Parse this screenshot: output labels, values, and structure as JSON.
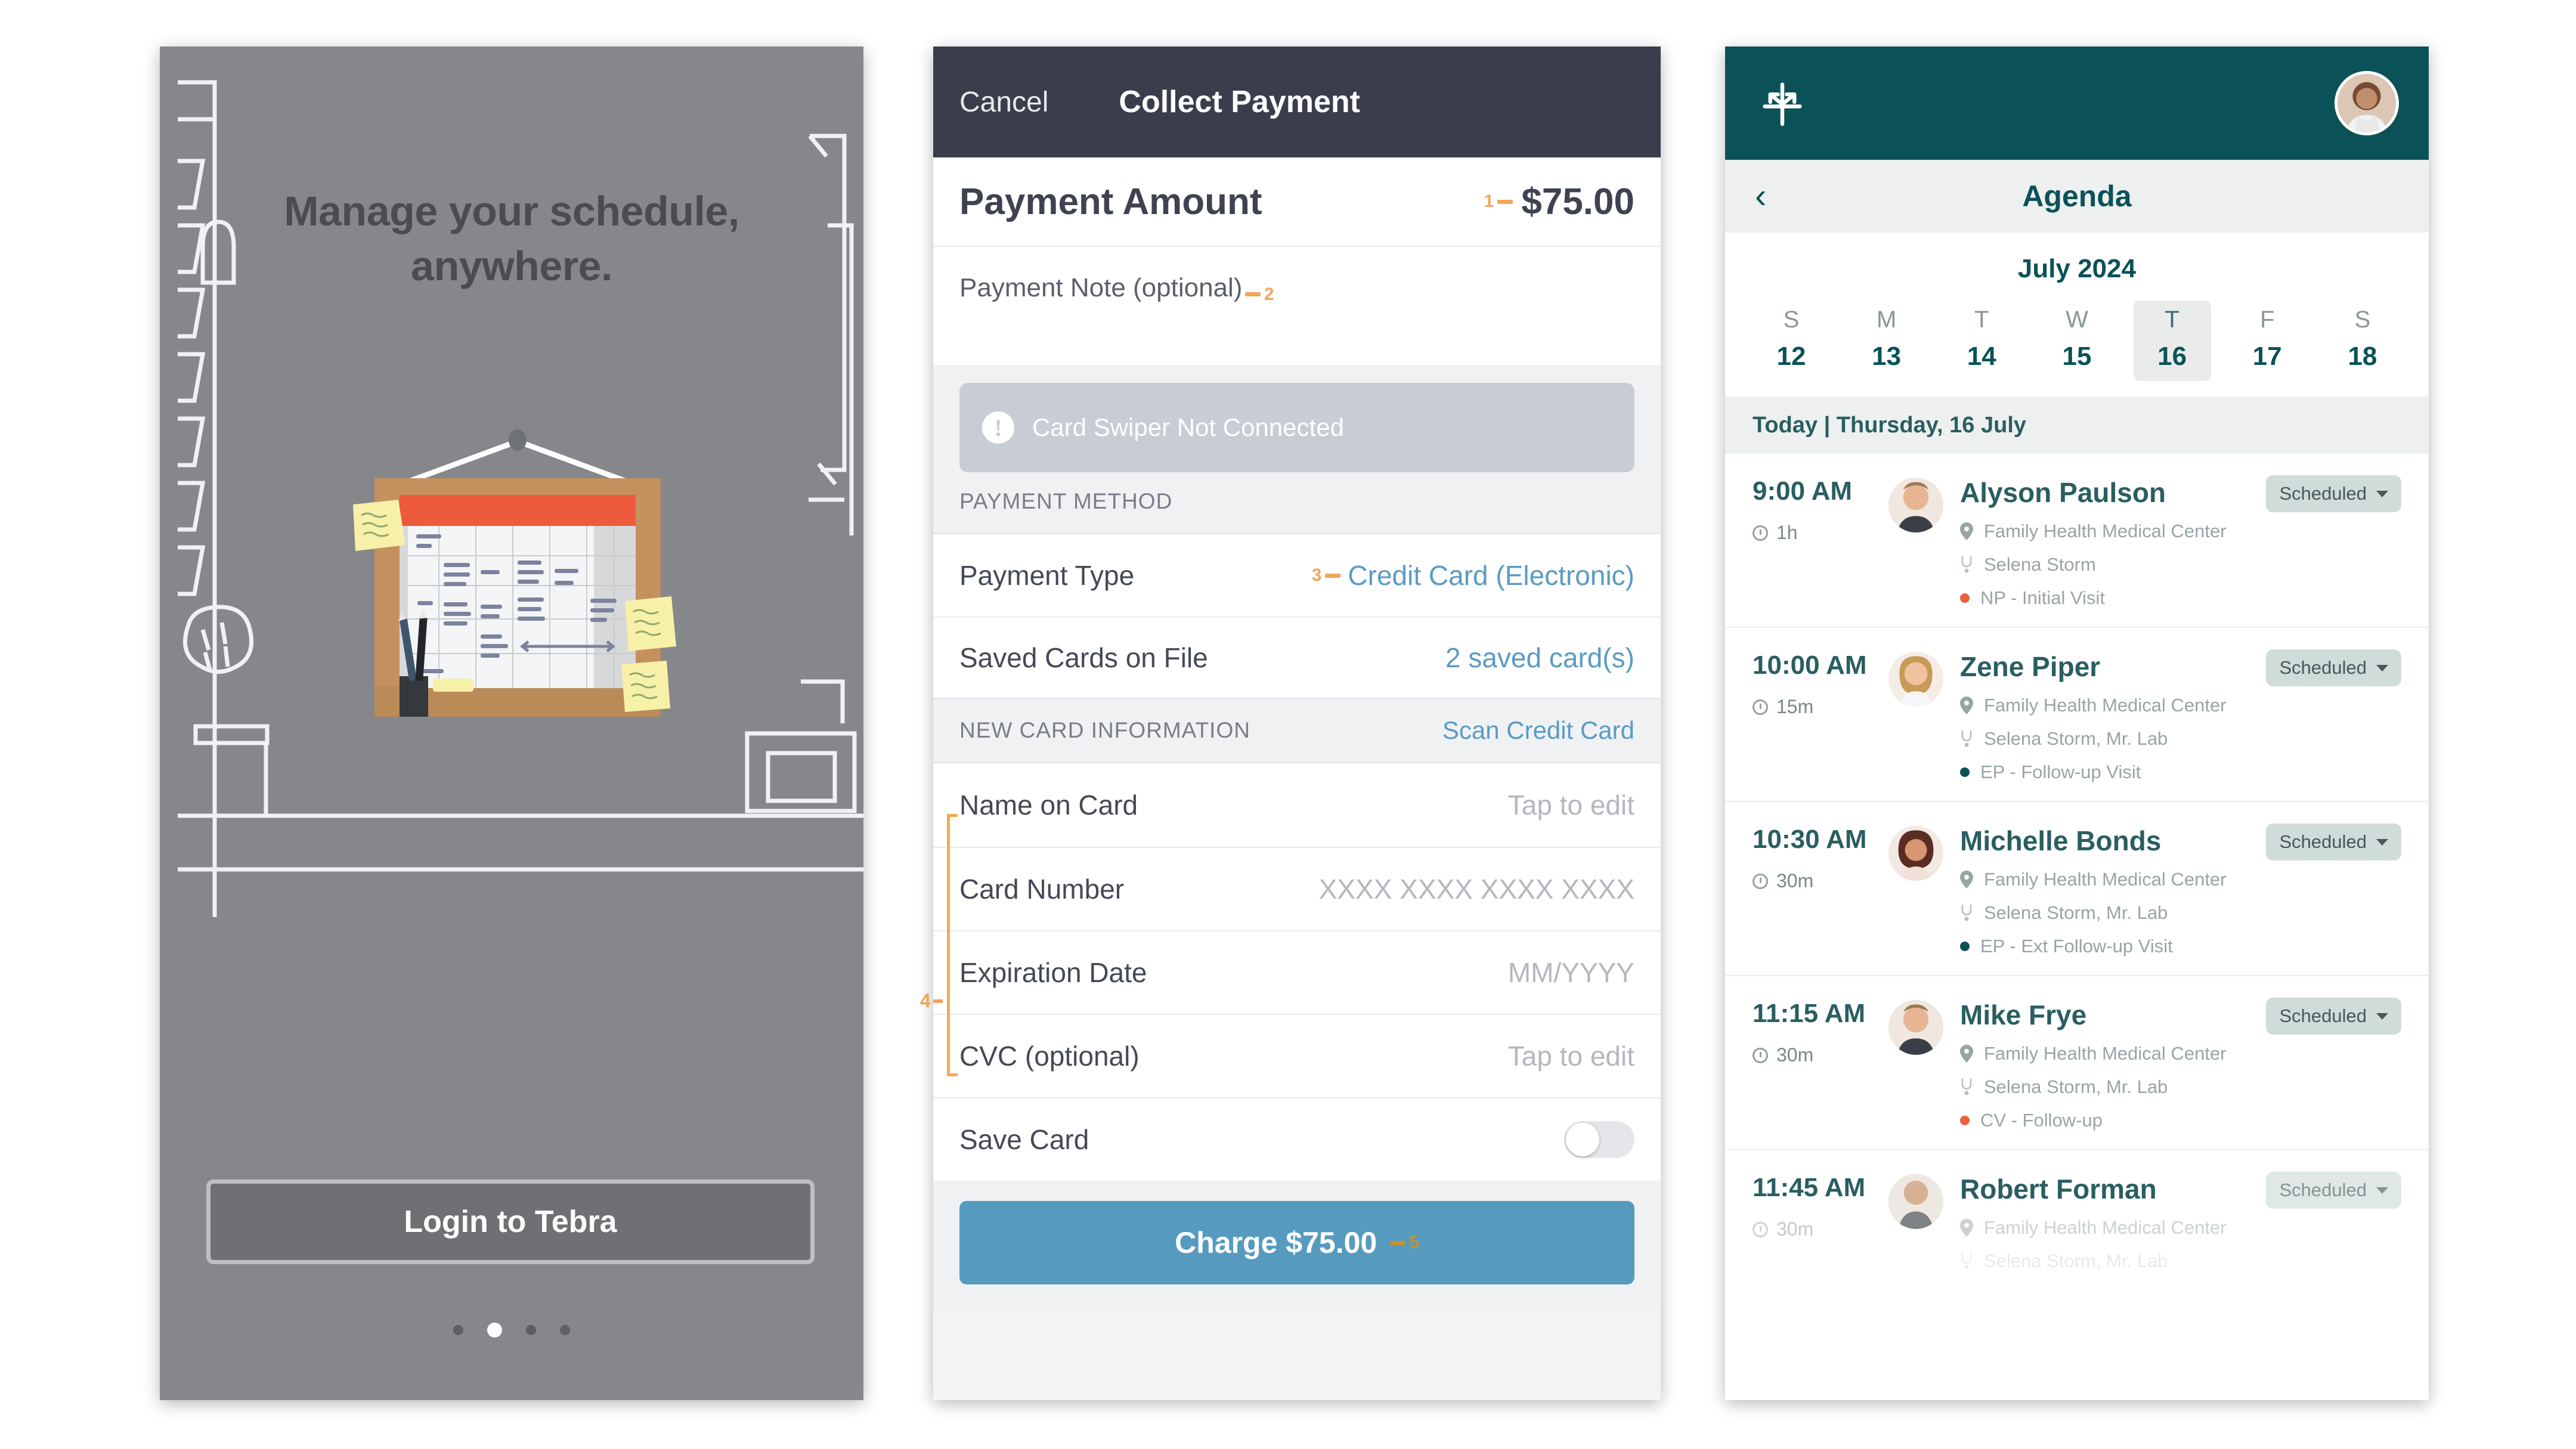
{
  "onboarding": {
    "headline": "Manage your schedule,\nanywhere.",
    "login_button": "Login to Tebra",
    "pager": {
      "count": 4,
      "active_index": 1
    },
    "illustration_name": "whiteboard-calendar-illustration"
  },
  "payment": {
    "nav": {
      "cancel": "Cancel",
      "title": "Collect Payment"
    },
    "amount_label": "Payment Amount",
    "amount_value": "$75.00",
    "amount_marker": "1",
    "note_label": "Payment Note (optional)",
    "note_marker": "2",
    "swiper_status": "Card Swiper Not Connected",
    "payment_method_caption": "PAYMENT METHOD",
    "payment_type_label": "Payment Type",
    "payment_type_value": "Credit Card (Electronic)",
    "payment_type_marker": "3",
    "saved_cards_label": "Saved Cards on File",
    "saved_cards_value": "2 saved card(s)",
    "new_card_caption": "NEW CARD INFORMATION",
    "scan_link": "Scan Credit Card",
    "new_card_marker": "4",
    "fields": [
      {
        "label": "Name on Card",
        "value": "Tap to edit"
      },
      {
        "label": "Card Number",
        "value": "XXXX XXXX XXXX XXXX"
      },
      {
        "label": "Expiration Date",
        "value": "MM/YYYY"
      },
      {
        "label": "CVC (optional)",
        "value": "Tap to edit"
      }
    ],
    "save_card_label": "Save Card",
    "save_card_on": false,
    "charge_button": "Charge $75.00",
    "charge_marker": "5",
    "colors": {
      "navbar": "#3A3D4C",
      "link": "#5A9BC4",
      "charge": "#569BBF",
      "marker": "#F0A55A"
    }
  },
  "agenda": {
    "sub_title": "Agenda",
    "month": "July 2024",
    "week": [
      {
        "dow": "S",
        "day": "12",
        "selected": false
      },
      {
        "dow": "M",
        "day": "13",
        "selected": false
      },
      {
        "dow": "T",
        "day": "14",
        "selected": false
      },
      {
        "dow": "W",
        "day": "15",
        "selected": false
      },
      {
        "dow": "T",
        "day": "16",
        "selected": true
      },
      {
        "dow": "F",
        "day": "17",
        "selected": false
      },
      {
        "dow": "S",
        "day": "18",
        "selected": false
      }
    ],
    "today_label": "Today | Thursday, 16 July",
    "status_label": "Scheduled",
    "appointments": [
      {
        "time": "9:00 AM",
        "duration": "1h",
        "patient": "Alyson Paulson",
        "location": "Family Health Medical Center",
        "provider": "Selena Storm",
        "visit": "NP - Initial Visit",
        "visit_color": "#E8603C",
        "status": "Scheduled"
      },
      {
        "time": "10:00 AM",
        "duration": "15m",
        "patient": "Zene Piper",
        "location": "Family Health Medical Center",
        "provider": "Selena Storm, Mr. Lab",
        "visit": "EP - Follow-up Visit",
        "visit_color": "#0A5258",
        "status": "Scheduled"
      },
      {
        "time": "10:30 AM",
        "duration": "30m",
        "patient": "Michelle Bonds",
        "location": "Family Health Medical Center",
        "provider": "Selena Storm, Mr. Lab",
        "visit": "EP - Ext Follow-up Visit",
        "visit_color": "#0A5258",
        "status": "Scheduled"
      },
      {
        "time": "11:15 AM",
        "duration": "30m",
        "patient": "Mike Frye",
        "location": "Family Health Medical Center",
        "provider": "Selena Storm, Mr. Lab",
        "visit": "CV - Follow-up",
        "visit_color": "#E8603C",
        "status": "Scheduled"
      },
      {
        "time": "11:45 AM",
        "duration": "30m",
        "patient": "Robert Forman",
        "location": "Family Health Medical Center",
        "provider": "Selena Storm, Mr. Lab",
        "visit": "",
        "visit_color": "#E8603C",
        "status": "Scheduled"
      }
    ],
    "colors": {
      "brand": "#0A5258",
      "badge": "#CFDCDA",
      "selected_day": "#EAECEC"
    }
  }
}
